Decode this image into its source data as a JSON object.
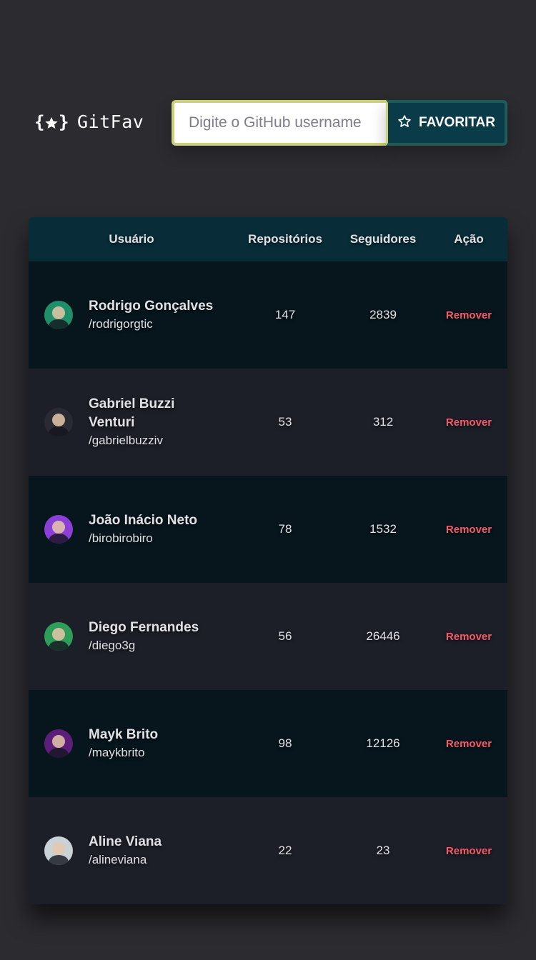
{
  "header": {
    "logo_text": "GitFav",
    "logo_icon": "star-braces-icon",
    "search_placeholder": "Digite o GitHub username",
    "favorite_label": "FAVORITAR",
    "favorite_icon": "star-outline-icon"
  },
  "colors": {
    "background": "#2c2b30",
    "header_row": "#092d38",
    "row_dark": "#06161c",
    "row_light": "#1c1f27",
    "remove": "#f75a68",
    "input_border": "#cbd17a"
  },
  "table": {
    "headers": {
      "user": "Usuário",
      "repos": "Repositórios",
      "followers": "Seguidores",
      "action": "Ação"
    },
    "rows": [
      {
        "name": "Rodrigo Gonçalves",
        "login": "/rodrigorgtic",
        "repos": "147",
        "followers": "2839",
        "action": "Remover",
        "avatar_color": "#1f8f6a"
      },
      {
        "name": "Gabriel Buzzi Venturi",
        "login": "/gabrielbuzziv",
        "repos": "53",
        "followers": "312",
        "action": "Remover",
        "avatar_color": "#2a2a33"
      },
      {
        "name": "João Inácio Neto",
        "login": "/birobirobiro",
        "repos": "78",
        "followers": "1532",
        "action": "Remover",
        "avatar_color": "#8b3fd6"
      },
      {
        "name": "Diego Fernandes",
        "login": "/diego3g",
        "repos": "56",
        "followers": "26446",
        "action": "Remover",
        "avatar_color": "#2f9d5a"
      },
      {
        "name": "Mayk Brito",
        "login": "/maykbrito",
        "repos": "98",
        "followers": "12126",
        "action": "Remover",
        "avatar_color": "#5b1f7a"
      },
      {
        "name": "Aline Viana",
        "login": "/alineviana",
        "repos": "22",
        "followers": "23",
        "action": "Remover",
        "avatar_color": "#c9d2d6"
      }
    ]
  }
}
